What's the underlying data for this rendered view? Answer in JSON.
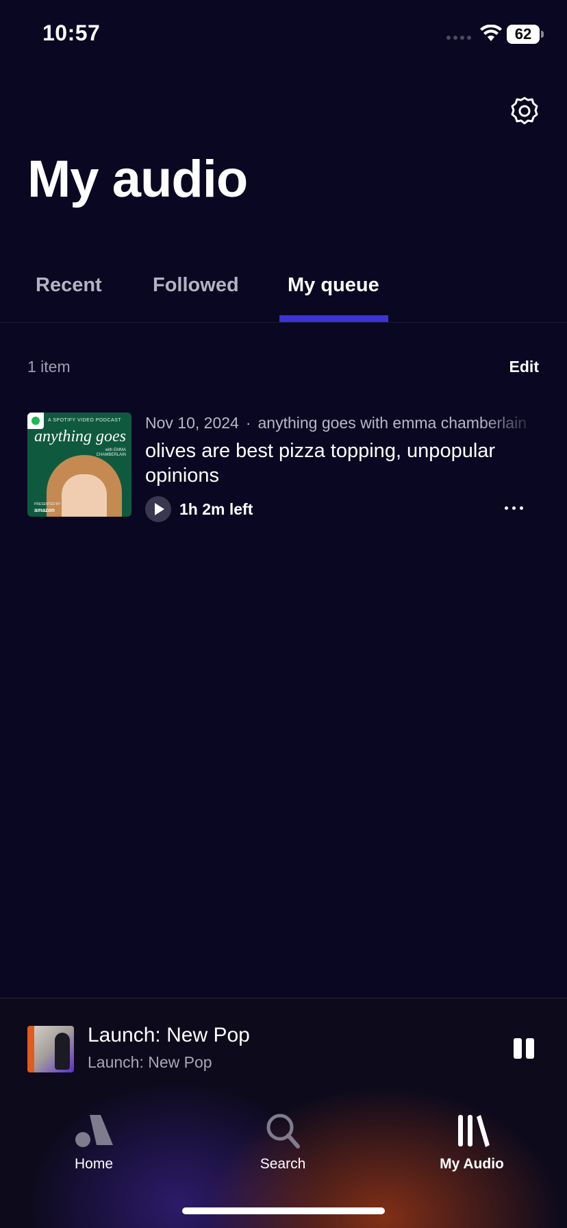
{
  "status_bar": {
    "time": "10:57",
    "battery": "62"
  },
  "header": {
    "title": "My audio",
    "settings_icon": "gear-icon"
  },
  "tabs": [
    {
      "label": "Recent",
      "active": false
    },
    {
      "label": "Followed",
      "active": false
    },
    {
      "label": "My queue",
      "active": true
    }
  ],
  "queue": {
    "count_label": "1 item",
    "edit_label": "Edit",
    "items": [
      {
        "cover": {
          "tag": "A SPOTIFY VIDEO PODCAST",
          "title": "anything goes",
          "with_line_1": "with EMMA",
          "with_line_2": "CHAMBERLAIN",
          "presented": "PRESENTED BY",
          "brand": "amazon"
        },
        "date": "Nov 10, 2024",
        "show": "anything goes with emma chamberlain",
        "title": "olives are best pizza topping, unpopular opinions",
        "time_left": "1h 2m left"
      }
    ]
  },
  "mini_player": {
    "title": "Launch: New Pop",
    "subtitle": "Launch: New Pop"
  },
  "nav": [
    {
      "label": "Home",
      "icon": "home-icon"
    },
    {
      "label": "Search",
      "icon": "search-icon"
    },
    {
      "label": "My Audio",
      "icon": "library-icon",
      "active": true
    }
  ],
  "colors": {
    "background": "#0a0722",
    "accent": "#3b33d6"
  }
}
